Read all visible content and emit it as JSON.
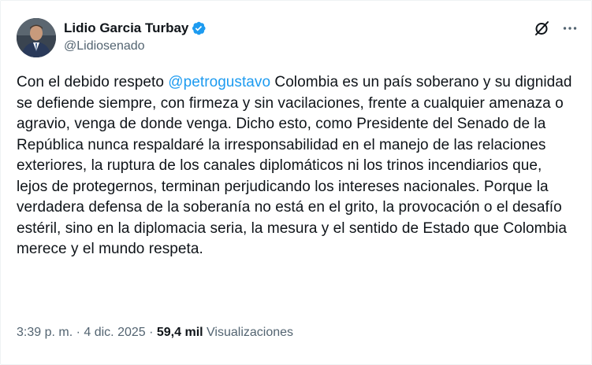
{
  "author": {
    "display_name": "Lidio Garcia Turbay",
    "handle": "@Lidiosenado",
    "verified": true,
    "verified_color": "#1d9bf0"
  },
  "header_actions": {
    "grok_icon": "grok-icon",
    "more_icon": "more-icon"
  },
  "tweet": {
    "part1": "Con el debido respeto ",
    "mention": "@petrogustavo",
    "part2": " Colombia es un país soberano y su dignidad se defiende siempre, con firmeza y sin vacilaciones, frente a cualquier amenaza o agravio, venga de donde venga. Dicho esto, como Presidente del Senado de la República nunca respaldaré la irresponsabilidad en el manejo de las relaciones exteriores, la ruptura de los canales diplomáticos ni los trinos incendiarios que, lejos de protegernos, terminan perjudicando los intereses nacionales. Porque la verdadera defensa de la soberanía no está en el grito, la provocación o el desafío estéril, sino en la diplomacia seria, la mesura y el sentido de Estado que Colombia merece y el mundo respeta."
  },
  "meta": {
    "time": "3:39 p. m.",
    "separator1": " · ",
    "date": "4 dic. 2025",
    "separator2": " · ",
    "views_count": "59,4 mil",
    "views_label": " Visualizaciones"
  },
  "colors": {
    "text": "#0f1419",
    "secondary": "#536471",
    "link": "#1d9bf0"
  }
}
